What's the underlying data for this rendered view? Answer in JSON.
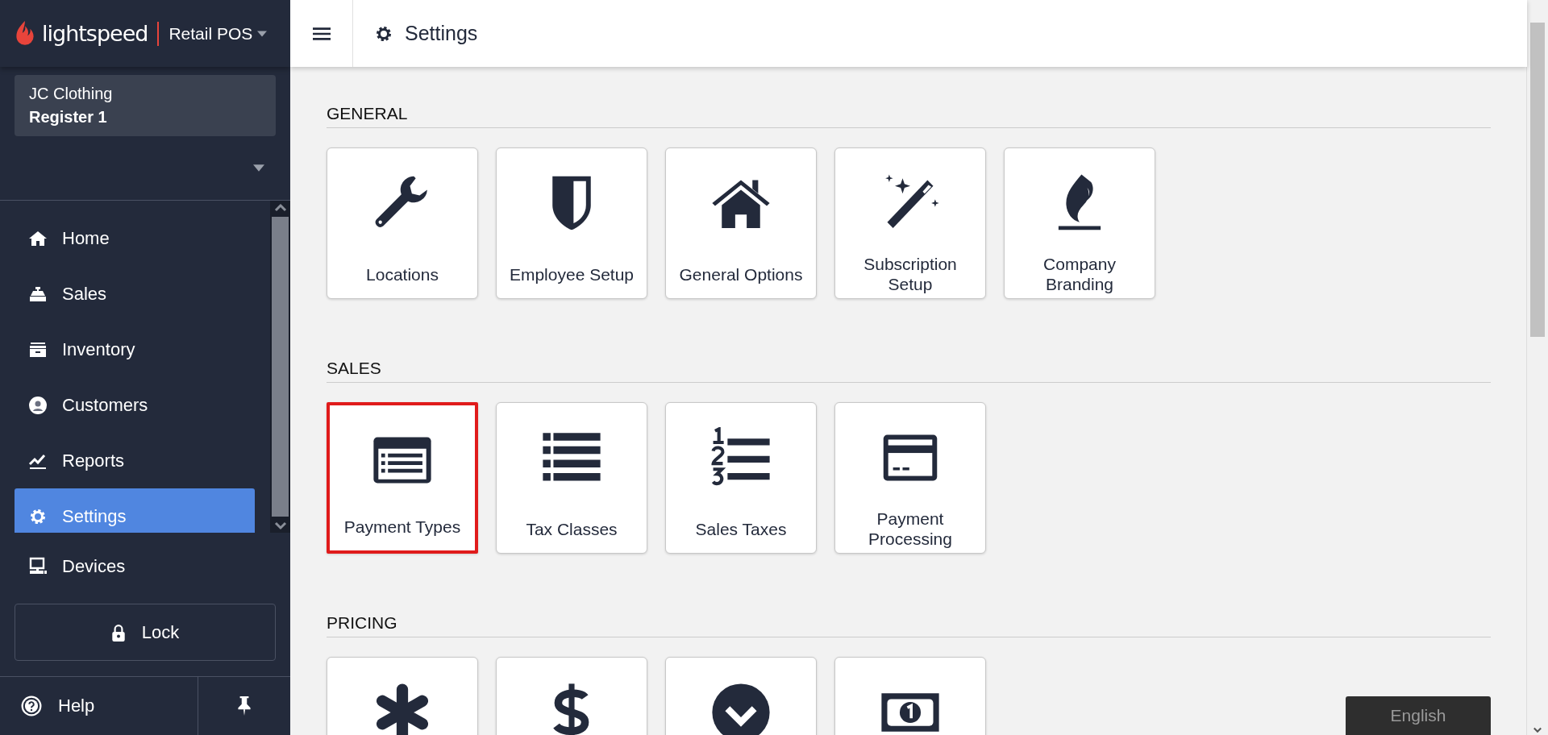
{
  "brand": {
    "logo_text": "lightspeed",
    "product": "Retail POS"
  },
  "store": {
    "name": "JC Clothing",
    "register": "Register 1"
  },
  "nav": [
    {
      "kind": "home",
      "label": "Home",
      "selected": false
    },
    {
      "kind": "sales",
      "label": "Sales",
      "selected": false
    },
    {
      "kind": "inventory",
      "label": "Inventory",
      "selected": false
    },
    {
      "kind": "customers",
      "label": "Customers",
      "selected": false
    },
    {
      "kind": "reports",
      "label": "Reports",
      "selected": false
    },
    {
      "kind": "settings",
      "label": "Settings",
      "selected": true
    }
  ],
  "devices": {
    "label": "Devices"
  },
  "lock_button": {
    "label": "Lock"
  },
  "help": {
    "label": "Help"
  },
  "header": {
    "title": "Settings"
  },
  "sections": [
    {
      "title": "GENERAL",
      "tiles": [
        {
          "kind": "wrench",
          "label": "Locations",
          "highlighted": false
        },
        {
          "kind": "shield",
          "label": "Employee Setup",
          "highlighted": false
        },
        {
          "kind": "house",
          "label": "General Options",
          "highlighted": false
        },
        {
          "kind": "wand",
          "label": "Subscription Setup",
          "highlighted": false
        },
        {
          "kind": "flame",
          "label": "Company Branding",
          "highlighted": false
        }
      ]
    },
    {
      "title": "SALES",
      "tiles": [
        {
          "kind": "window-list",
          "label": "Payment Types",
          "highlighted": true
        },
        {
          "kind": "list",
          "label": "Tax Classes",
          "highlighted": false
        },
        {
          "kind": "numbered-list",
          "label": "Sales Taxes",
          "highlighted": false
        },
        {
          "kind": "card",
          "label": "Payment Processing",
          "highlighted": false
        }
      ]
    },
    {
      "title": "PRICING",
      "tiles": [
        {
          "kind": "asterisk",
          "highlighted": false
        },
        {
          "kind": "dollar",
          "highlighted": false
        },
        {
          "kind": "chevron-circle",
          "highlighted": false
        },
        {
          "kind": "banknote",
          "highlighted": false
        }
      ]
    }
  ],
  "language_button": {
    "label": "English"
  }
}
